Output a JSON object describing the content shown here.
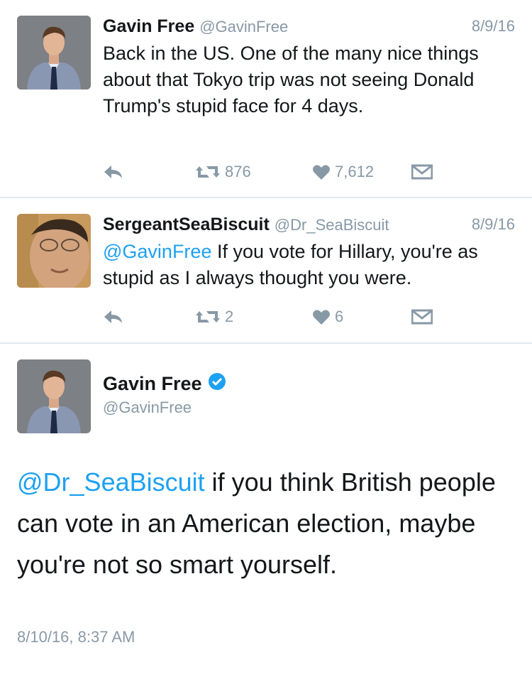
{
  "tweet1": {
    "name": "Gavin Free",
    "handle": "@GavinFree",
    "date": "8/9/16",
    "text": "Back in the US. One of the many nice things about that Tokyo trip was not seeing Donald Trump's stupid face for 4 days.",
    "retweets": "876",
    "likes": "7,612"
  },
  "tweet2": {
    "name": "SergeantSeaBiscuit",
    "handle": "@Dr_SeaBiscuit",
    "date": "8/9/16",
    "mention": "@GavinFree",
    "text": " If you vote for Hillary, you're as stupid as I always thought you were.",
    "retweets": "2",
    "likes": "6"
  },
  "tweet3": {
    "name": "Gavin Free",
    "handle": "@GavinFree",
    "mention": "@Dr_SeaBiscuit",
    "text": " if you think British people can vote in an American election, maybe you're not so smart yourself.",
    "timestamp": "8/10/16, 8:37 AM"
  },
  "colors": {
    "link": "#1da1f2",
    "muted": "#8899a6",
    "divider": "#e1e8ed",
    "verified": "#1da1f2"
  },
  "icons": {
    "reply": "reply-icon",
    "retweet": "retweet-icon",
    "like": "heart-icon",
    "dm": "envelope-icon",
    "verified": "verified-badge-icon"
  }
}
